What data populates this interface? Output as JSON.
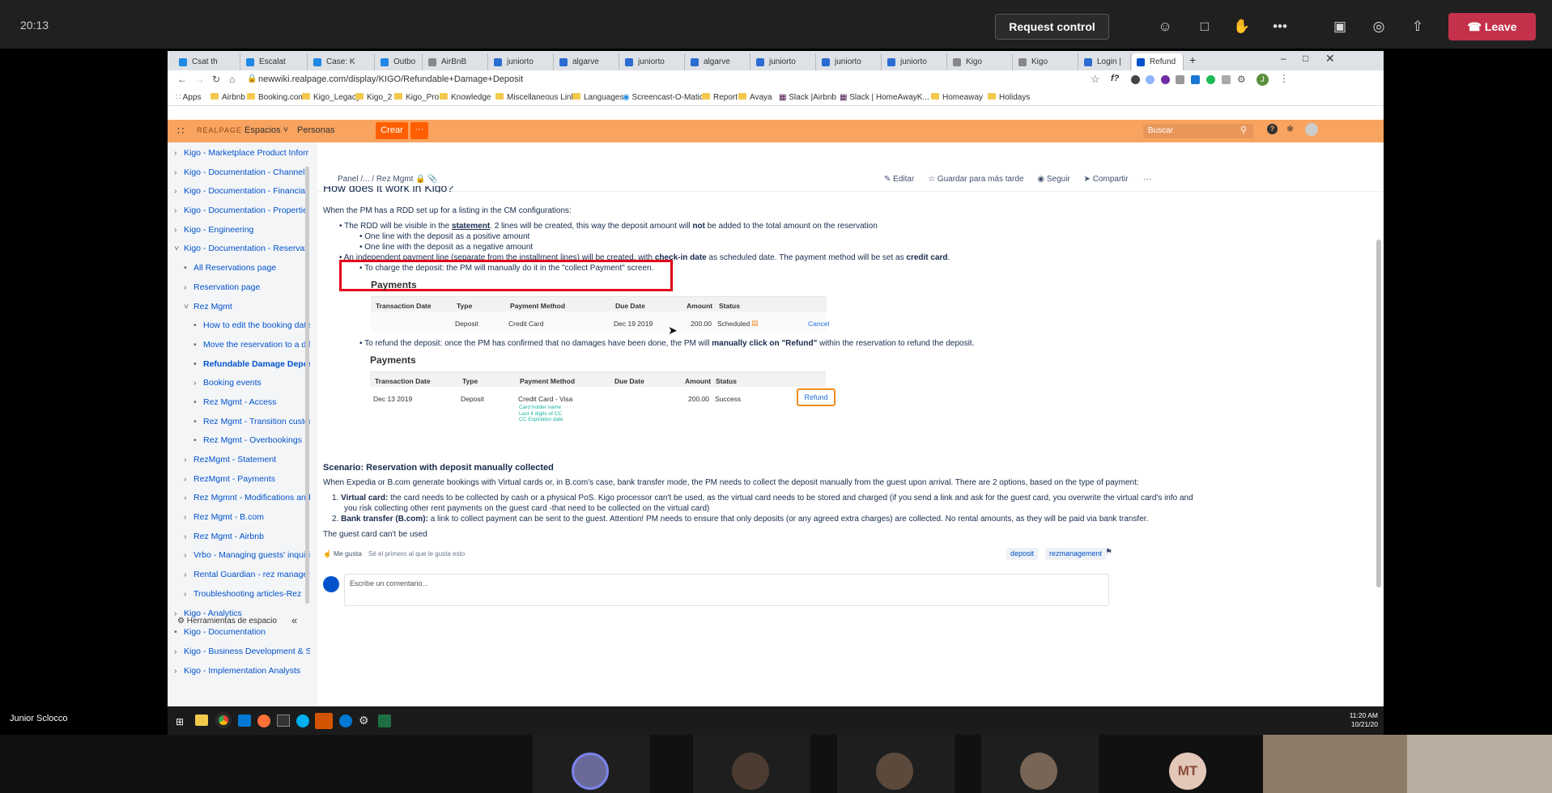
{
  "teams": {
    "clock": "20:13",
    "request_control": "Request control",
    "leave": "Leave",
    "presenter": "Junior Sclocco",
    "participant_initials": "MT"
  },
  "browser": {
    "tabs": [
      "Csat th",
      "Escalat",
      "Case: K",
      "Outbo",
      "AirBnB",
      "juniorto",
      "algarve",
      "juniorto",
      "algarve",
      "juniorto",
      "juniorto",
      "juniorto",
      "Kigo",
      "Kigo",
      "Login |",
      "Refund"
    ],
    "url": "newwiki.realpage.com/display/KIGO/Refundable+Damage+Deposit",
    "bookmarks": [
      "Apps",
      "Airbnb",
      "Booking.com",
      "Kigo_Legacy",
      "Kigo_2",
      "Kigo_Pro",
      "Knowledge",
      "Miscellaneous Links",
      "Languages",
      "Screencast-O-Matic",
      "Report",
      "Avaya",
      "Slack |Airbnb",
      "Slack | HomeAwayK...",
      "Homeaway",
      "Holidays"
    ]
  },
  "confluence": {
    "logo": "REALPAGE",
    "nav": {
      "espacios": "Espacios",
      "personas": "Personas",
      "crear": "Crear",
      "more": "···"
    },
    "search_placeholder": "Buscar",
    "breadcrumb": {
      "panel": "Panel",
      "ellipsis": "/...",
      "sep": "/",
      "current": "Rez Mgmt"
    },
    "actions": {
      "edit": "Editar",
      "save": "Guardar para más tarde",
      "follow": "Seguir",
      "share": "Compartir",
      "more": "···"
    },
    "sidebar": [
      {
        "label": "Kigo - Marketplace Product Inforr",
        "mark": "›",
        "indent": 0
      },
      {
        "label": "Kigo - Documentation - Channel I",
        "mark": "›",
        "indent": 0
      },
      {
        "label": "Kigo - Documentation - Financial",
        "mark": "›",
        "indent": 0
      },
      {
        "label": "Kigo - Documentation - Propertie",
        "mark": "›",
        "indent": 0
      },
      {
        "label": "Kigo - Engineering",
        "mark": "›",
        "indent": 0
      },
      {
        "label": "Kigo - Documentation - Reservati",
        "mark": "˅",
        "indent": 0
      },
      {
        "label": "All Reservations page",
        "mark": "•",
        "indent": 1
      },
      {
        "label": "Reservation page",
        "mark": "›",
        "indent": 1
      },
      {
        "label": "Rez Mgmt",
        "mark": "˅",
        "indent": 1
      },
      {
        "label": "How to edit the booking date",
        "mark": "•",
        "indent": 2
      },
      {
        "label": "Move the reservation to a dif",
        "mark": "•",
        "indent": 2
      },
      {
        "label": "Refundable Damage Depos",
        "mark": "•",
        "indent": 2,
        "current": true
      },
      {
        "label": "Booking events",
        "mark": "›",
        "indent": 2
      },
      {
        "label": "Rez Mgmt - Access",
        "mark": "•",
        "indent": 2
      },
      {
        "label": "Rez Mgmt - Transition custon",
        "mark": "•",
        "indent": 2
      },
      {
        "label": "Rez Mgmt - Overbookings",
        "mark": "•",
        "indent": 2
      },
      {
        "label": "RezMgmt - Statement",
        "mark": "›",
        "indent": 1
      },
      {
        "label": "RezMgmt - Payments",
        "mark": "›",
        "indent": 1
      },
      {
        "label": "Rez Mgmnt - Modifications and",
        "mark": "›",
        "indent": 1
      },
      {
        "label": "Rez Mgmt - B.com",
        "mark": "›",
        "indent": 1
      },
      {
        "label": "Rez Mgmt - Airbnb",
        "mark": "›",
        "indent": 1
      },
      {
        "label": "Vrbo - Managing guests' inquiri",
        "mark": "›",
        "indent": 1
      },
      {
        "label": "Rental Guardian - rez managem",
        "mark": "›",
        "indent": 1
      },
      {
        "label": "Troubleshooting articles-Rez",
        "mark": "›",
        "indent": 1
      },
      {
        "label": "Kigo - Analytics",
        "mark": "›",
        "indent": 0
      },
      {
        "label": "Kigo - Documentation",
        "mark": "•",
        "indent": 0
      },
      {
        "label": "Kigo - Business Development & S",
        "mark": "›",
        "indent": 0
      },
      {
        "label": "Kigo - Implementation Analysts",
        "mark": "›",
        "indent": 0
      }
    ],
    "space_tools": "Herramientas de espacio",
    "article": {
      "heading_cut": "How does it work in Kigo?",
      "intro": "When the PM has a RDD set up for a listing in the CM configurations:",
      "b1_pre": "The RDD will be visible in the ",
      "b1_link": "statement",
      "b1_mid": ". 2 lines will be created, this way the deposit amount will ",
      "b1_bold": "not",
      "b1_post": " be added to the total amount on the reservation",
      "b1a": "One line with the deposit as a positive amount",
      "b1b": "One line with the deposit as a negative amount",
      "b2_pre": "An independent payment line (separate from the installment lines) will be created, with ",
      "b2_bold1": "check-in date",
      "b2_mid": " as scheduled date. The payment method will be set as ",
      "b2_bold2": "credit card",
      "b2_post": ".",
      "charge": "To charge the deposit: the PM will manually do it in the \"collect Payment\" screen.",
      "payments1": {
        "title": "Payments",
        "headers": [
          "Transaction Date",
          "Type",
          "Payment Method",
          "Due Date",
          "Amount",
          "Status"
        ],
        "row": [
          "",
          "Deposit",
          "Credit Card",
          "Dec 19 2019",
          "200.00",
          "Scheduled"
        ],
        "action": "Cancel"
      },
      "refund_pre": "To refund the deposit: once the PM has confirmed that no damages have been done, the PM will ",
      "refund_bold": "manually click on \"Refund\"",
      "refund_post": " within the reservation to refund the deposit.",
      "payments2": {
        "title": "Payments",
        "headers": [
          "Transaction Date",
          "Type",
          "Payment Method",
          "Due Date",
          "Amount",
          "Status"
        ],
        "row": [
          "Dec 13 2019",
          "Deposit",
          "Credit Card - Visa",
          "",
          "200.00",
          "Success"
        ],
        "action": "Refund",
        "card_notes": [
          "Card holder name",
          "Last 4 digits of CC",
          "CC Expiration date"
        ]
      },
      "scenario_title": "Scenario: Reservation with deposit manually collected",
      "scenario_intro": "When Expedia or B.com generate bookings with Virtual cards or, in B.com's case, bank transfer mode, the PM needs to collect the deposit manually from the guest upon arrival. There are 2 options, based on the type of payment:",
      "vc_label": "Virtual card:",
      "vc_text1": " the card needs to be collected by cash or a physical PoS. Kigo processor can't be used, as the virtual card needs to be stored and charged (if you send a link and ask for the guest card, you overwrite the virtual card's info and",
      "vc_text2": "you risk collecting other rent payments on the guest card -that need to be collected on the virtual card)",
      "bt_label": "Bank transfer (B.com):",
      "bt_text": " a link to collect payment can be sent to the guest. Attention! PM needs to ensure that only deposits (or any agreed extra charges) are collected. No rental amounts, as they will be paid via bank transfer.",
      "guest_card": "The guest card can't be used",
      "like": "Me gusta",
      "first_like": "Sé el primero al que le gusta esto",
      "labels": [
        "deposit",
        "rezmanagement"
      ],
      "comment_placeholder": "Escribe un comentario..."
    }
  },
  "taskbar": {
    "time": "11:20 AM",
    "date": "10/21/20"
  },
  "colors": {
    "highlight": "#e2001a",
    "refund_border": "#f08a24",
    "header": "#f8a35f",
    "crear": "#ff5f00",
    "link": "#0052cc",
    "leave": "#c4314b"
  }
}
